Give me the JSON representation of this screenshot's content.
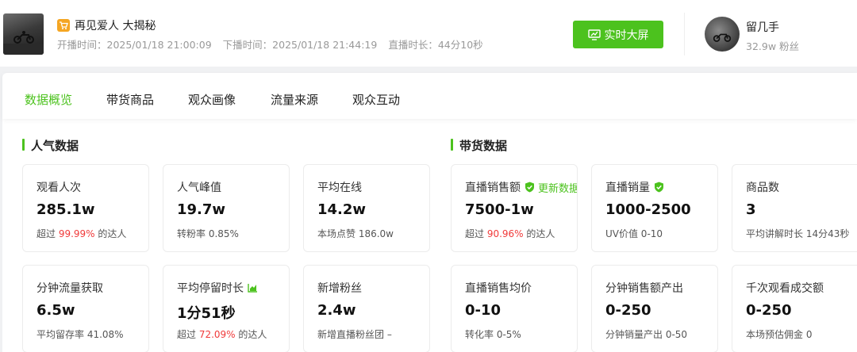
{
  "header": {
    "live_title": "再见爱人 大揭秘",
    "start_time": "开播时间：2025/01/18 21:00:09",
    "end_time": "下播时间：2025/01/18 21:44:19",
    "duration": "直播时长：44分10秒",
    "screen_button": "实时大屏",
    "author_name": "留几手",
    "author_fans": "32.9w 粉丝"
  },
  "tabs": [
    "数据概览",
    "带货商品",
    "观众画像",
    "流量来源",
    "观众互动"
  ],
  "sections": {
    "popularity": "人气数据",
    "sales": "带货数据"
  },
  "cards": {
    "views": {
      "label": "观看人次",
      "value": "285.1w",
      "sub_prefix": "超过 ",
      "sub_highlight": "99.99%",
      "sub_suffix": " 的达人"
    },
    "peak": {
      "label": "人气峰值",
      "value": "19.7w",
      "sub": "转粉率 0.85%"
    },
    "avg_online": {
      "label": "平均在线",
      "value": "14.2w",
      "sub": "本场点赞 186.0w"
    },
    "traffic_per_min": {
      "label": "分钟流量获取",
      "value": "6.5w",
      "sub": "平均留存率 41.08%"
    },
    "avg_stay": {
      "label": "平均停留时长",
      "value": "1分51秒",
      "sub_prefix": "超过 ",
      "sub_highlight": "72.09%",
      "sub_suffix": " 的达人"
    },
    "new_fans": {
      "label": "新增粉丝",
      "value": "2.4w",
      "sub": "新增直播粉丝团 –"
    },
    "sales_amount": {
      "label": "直播销售额",
      "update": "更新数据",
      "value": "7500-1w",
      "sub_prefix": "超过 ",
      "sub_highlight": "90.96%",
      "sub_suffix": " 的达人"
    },
    "sales_volume": {
      "label": "直播销量",
      "value": "1000-2500",
      "sub": "UV价值 0-10"
    },
    "product_count": {
      "label": "商品数",
      "value": "3",
      "sub": "平均讲解时长 14分43秒"
    },
    "avg_price": {
      "label": "直播销售均价",
      "value": "0-10",
      "sub": "转化率 0-5%"
    },
    "sales_per_min": {
      "label": "分钟销售额产出",
      "value": "0-250",
      "sub": "分钟销量产出 0-50"
    },
    "gpm": {
      "label": "千次观看成交额",
      "value": "0-250",
      "sub": "本场预估佣金 0"
    }
  },
  "colors": {
    "accent": "#4cc21e",
    "highlight": "#f03a3a"
  }
}
